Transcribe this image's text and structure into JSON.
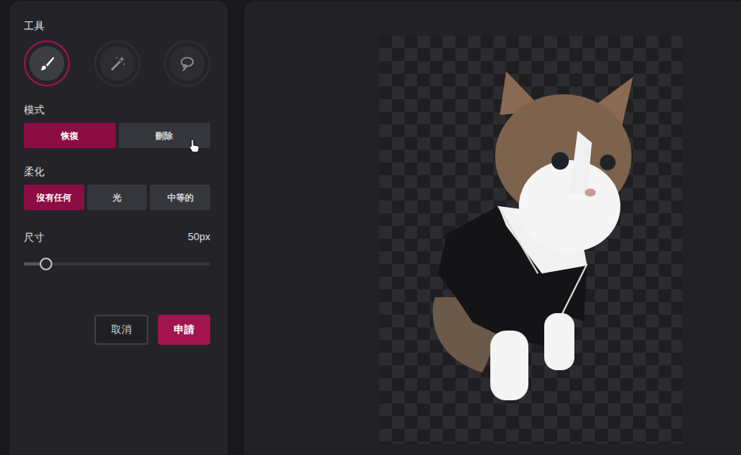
{
  "tools_label": "工具",
  "tools": [
    {
      "kind": "brush",
      "selected": true
    },
    {
      "kind": "wand",
      "selected": false
    },
    {
      "kind": "lasso",
      "selected": false
    }
  ],
  "mode": {
    "label": "模式",
    "options": [
      {
        "label": "恢復",
        "selected": true
      },
      {
        "label": "刪除",
        "selected": false
      }
    ]
  },
  "feather": {
    "label": "柔化",
    "options": [
      {
        "label": "沒有任何",
        "selected": true
      },
      {
        "label": "光",
        "selected": false
      },
      {
        "label": "中等的",
        "selected": false
      }
    ]
  },
  "size": {
    "label": "尺寸",
    "reading": "50px",
    "level": 0.12
  },
  "buttons": [
    {
      "label": "取消",
      "kind": "secondary"
    },
    {
      "label": "申請",
      "kind": "primary"
    }
  ]
}
